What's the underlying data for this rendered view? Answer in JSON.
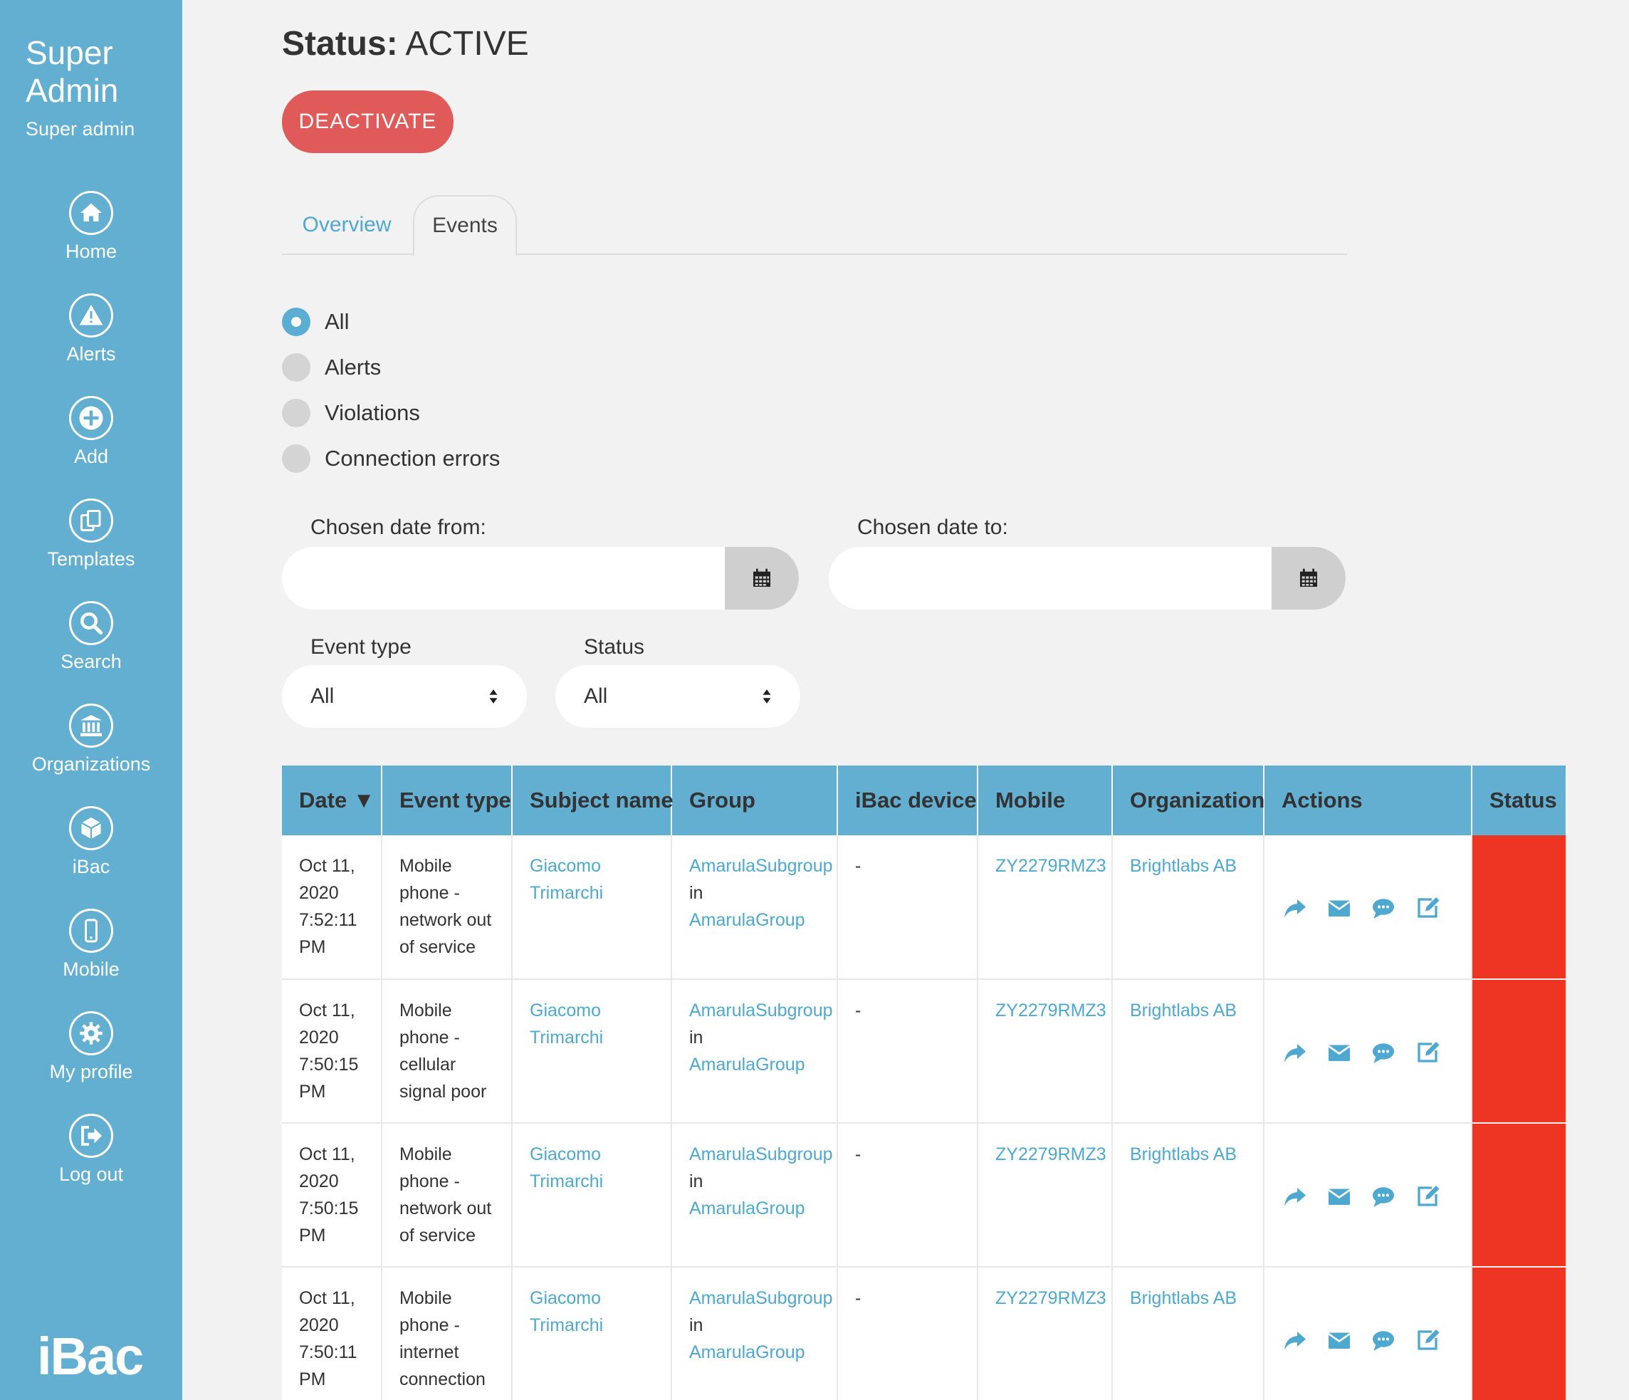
{
  "sidebar": {
    "title_line1": "Super",
    "title_line2": "Admin",
    "subtitle": "Super admin",
    "items": [
      {
        "label": "Home",
        "icon": "home-icon"
      },
      {
        "label": "Alerts",
        "icon": "warning-icon"
      },
      {
        "label": "Add",
        "icon": "plus-icon"
      },
      {
        "label": "Templates",
        "icon": "copy-icon"
      },
      {
        "label": "Search",
        "icon": "search-icon"
      },
      {
        "label": "Organizations",
        "icon": "bank-icon"
      },
      {
        "label": "iBac",
        "icon": "cube-icon"
      },
      {
        "label": "Mobile",
        "icon": "mobile-icon"
      },
      {
        "label": "My profile",
        "icon": "gear-icon"
      },
      {
        "label": "Log out",
        "icon": "logout-icon"
      }
    ],
    "logo": "iBac"
  },
  "main": {
    "status_label": "Status:",
    "status_value": "ACTIVE",
    "deactivate_label": "DEACTIVATE",
    "tabs": [
      {
        "label": "Overview",
        "active": false
      },
      {
        "label": "Events",
        "active": true
      }
    ],
    "filters": {
      "radios": [
        {
          "label": "All",
          "checked": true
        },
        {
          "label": "Alerts",
          "checked": false
        },
        {
          "label": "Violations",
          "checked": false
        },
        {
          "label": "Connection errors",
          "checked": false
        }
      ],
      "date_from_label": "Chosen date from:",
      "date_from_value": "",
      "date_to_label": "Chosen date to:",
      "date_to_value": "",
      "event_type_label": "Event type",
      "event_type_value": "All",
      "status_label": "Status",
      "status_value": "All"
    }
  },
  "table": {
    "columns": [
      "Date ▼",
      "Event type",
      "Subject name",
      "Group",
      "iBac device",
      "Mobile",
      "Organization",
      "Actions",
      "Status"
    ],
    "rows": [
      {
        "date": [
          "Oct 11,",
          "2020",
          "7:52:11",
          "PM"
        ],
        "event_type": [
          "Mobile",
          "phone -",
          "network out",
          "of service"
        ],
        "subject": [
          "Giacomo",
          "Trimarchi"
        ],
        "subgroup": "AmarulaSubgroup",
        "in": "in",
        "group": "AmarulaGroup",
        "device": "-",
        "mobile": "ZY2279RMZ3",
        "organization": "Brightlabs AB"
      },
      {
        "date": [
          "Oct 11,",
          "2020",
          "7:50:15",
          "PM"
        ],
        "event_type": [
          "Mobile",
          "phone -",
          "cellular",
          "signal poor"
        ],
        "subject": [
          "Giacomo",
          "Trimarchi"
        ],
        "subgroup": "AmarulaSubgroup",
        "in": "in",
        "group": "AmarulaGroup",
        "device": "-",
        "mobile": "ZY2279RMZ3",
        "organization": "Brightlabs AB"
      },
      {
        "date": [
          "Oct 11,",
          "2020",
          "7:50:15",
          "PM"
        ],
        "event_type": [
          "Mobile",
          "phone -",
          "network out",
          "of service"
        ],
        "subject": [
          "Giacomo",
          "Trimarchi"
        ],
        "subgroup": "AmarulaSubgroup",
        "in": "in",
        "group": "AmarulaGroup",
        "device": "-",
        "mobile": "ZY2279RMZ3",
        "organization": "Brightlabs AB"
      },
      {
        "date": [
          "Oct 11,",
          "2020",
          "7:50:11",
          "PM"
        ],
        "event_type": [
          "Mobile",
          "phone -",
          "internet",
          "connection"
        ],
        "subject": [
          "Giacomo",
          "Trimarchi"
        ],
        "subgroup": "AmarulaSubgroup",
        "in": "in",
        "group": "AmarulaGroup",
        "device": "-",
        "mobile": "ZY2279RMZ3",
        "organization": "Brightlabs AB"
      }
    ],
    "status_color": "#ee3423"
  },
  "colors": {
    "sidebar": "#63afd1",
    "accent": "#4fa8cf",
    "danger": "#e05a5a"
  }
}
